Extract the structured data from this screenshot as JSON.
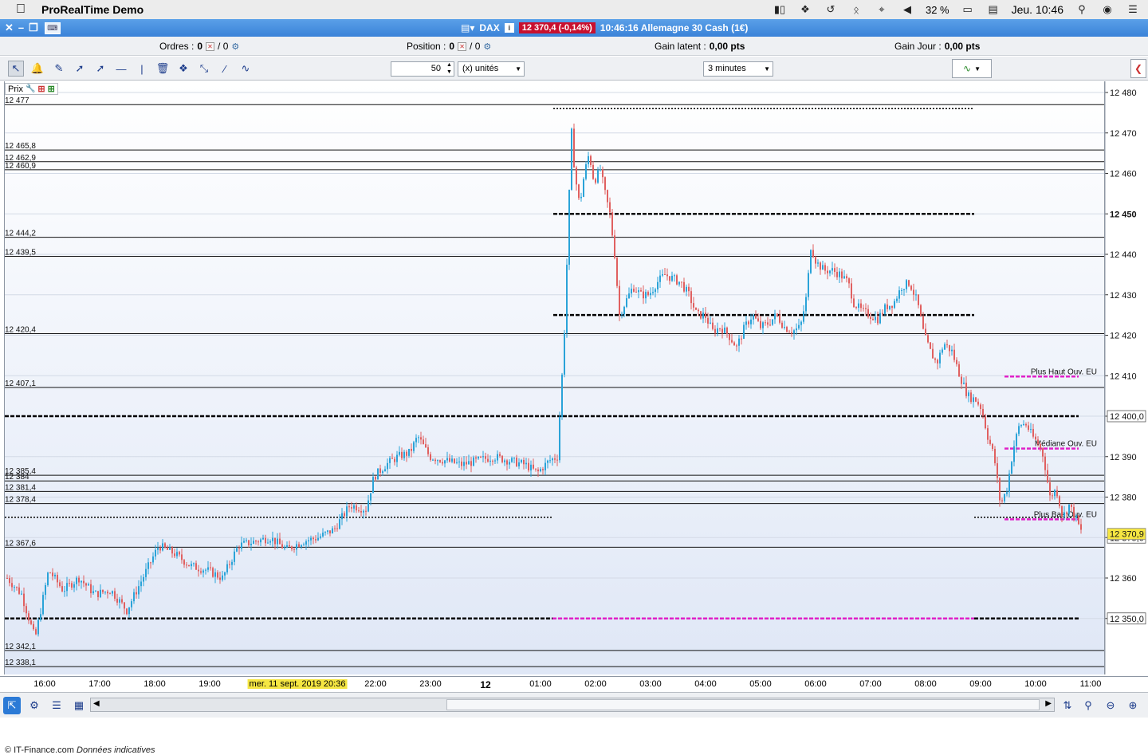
{
  "menubar": {
    "app_name": "ProRealTime Demo",
    "battery": "32 %",
    "clock": "Jeu. 10:46"
  },
  "titlebar": {
    "instrument": "DAX",
    "price_change": "12 370,4 (-0,14%)",
    "info": "10:46:16 Allemagne 30 Cash (1€)"
  },
  "orderbar": {
    "orders_label": "Ordres :",
    "orders_value": "0",
    "orders_sep": "/ 0",
    "position_label": "Position :",
    "position_value": "0",
    "position_sep": "/ 0",
    "gain_latent_label": "Gain latent :",
    "gain_latent_value": "0,00 pts",
    "gain_jour_label": "Gain Jour :",
    "gain_jour_value": "0,00 pts"
  },
  "toolbar": {
    "quantity": "50",
    "unit_select": "(x) unités",
    "timeframe_select": "3 minutes"
  },
  "chart": {
    "prix_label": "Prix",
    "footer_source": "© IT-Finance.com",
    "footer_note": "Données indicatives",
    "time_labels": [
      "16:00",
      "17:00",
      "18:00",
      "19:00",
      "mer. 11 sept. 2019 20:36",
      "22:00",
      "23:00",
      "12",
      "01:00",
      "02:00",
      "03:00",
      "04:00",
      "05:00",
      "06:00",
      "07:00",
      "08:00",
      "09:00",
      "10:00",
      "11:00"
    ]
  },
  "chart_data": {
    "type": "candlestick",
    "title": "DAX",
    "timeframe": "3 minutes",
    "y_axis_ticks": [
      12480,
      12470,
      12460,
      12450,
      12440,
      12430,
      12420,
      12410,
      12400,
      12390,
      12380,
      12370,
      12360,
      12350
    ],
    "y_axis_labels": [
      "12 480",
      "12 470",
      "12 460",
      "12 450",
      "12 440",
      "12 430",
      "12 420",
      "12 410",
      "12 400,0",
      "12 390",
      "12 380",
      "12 375,0",
      "12 360",
      "12 350,0"
    ],
    "ylim": [
      12337,
      12483
    ],
    "last_price": "12 370,9",
    "horizontal_levels": [
      {
        "label": "12 477",
        "value": 12477
      },
      {
        "label": "12 465,8",
        "value": 12465.8
      },
      {
        "label": "12 462,9",
        "value": 12462.9
      },
      {
        "label": "12 460,9",
        "value": 12460.9
      },
      {
        "label": "12 444,2",
        "value": 12444.2
      },
      {
        "label": "12 439,5",
        "value": 12439.5
      },
      {
        "label": "12 420,4",
        "value": 12420.4
      },
      {
        "label": "12 407,1",
        "value": 12407.1
      },
      {
        "label": "12 385,4",
        "value": 12385.4
      },
      {
        "label": "12 384",
        "value": 12384
      },
      {
        "label": "12 381,4",
        "value": 12381.4
      },
      {
        "label": "12 378,4",
        "value": 12378.4
      },
      {
        "label": "12 367,6",
        "value": 12367.6
      },
      {
        "label": "12 342,1",
        "value": 12342.1
      },
      {
        "label": "12 338,1",
        "value": 12338.1
      }
    ],
    "annotations": [
      {
        "text": "Plus Haut Ouv. EU",
        "value": 12409.8
      },
      {
        "text": "Médiane Ouv. EU",
        "value": 12392
      },
      {
        "text": "Plus Bas Ouv. EU",
        "value": 12374.5
      }
    ],
    "close_path": [
      [
        0,
        12360
      ],
      [
        18,
        12356
      ],
      [
        35,
        12345
      ],
      [
        52,
        12362
      ],
      [
        70,
        12357
      ],
      [
        90,
        12360
      ],
      [
        110,
        12356
      ],
      [
        130,
        12357
      ],
      [
        150,
        12352
      ],
      [
        170,
        12360
      ],
      [
        190,
        12368
      ],
      [
        210,
        12366
      ],
      [
        230,
        12363
      ],
      [
        250,
        12362
      ],
      [
        270,
        12360
      ],
      [
        290,
        12368
      ],
      [
        310,
        12369
      ],
      [
        330,
        12370
      ],
      [
        350,
        12367
      ],
      [
        370,
        12369
      ],
      [
        390,
        12370
      ],
      [
        410,
        12372
      ],
      [
        430,
        12378
      ],
      [
        450,
        12377
      ],
      [
        460,
        12385
      ],
      [
        475,
        12388
      ],
      [
        490,
        12390
      ],
      [
        505,
        12391
      ],
      [
        515,
        12395
      ],
      [
        530,
        12390
      ],
      [
        550,
        12389
      ],
      [
        570,
        12388
      ],
      [
        590,
        12389
      ],
      [
        610,
        12390
      ],
      [
        630,
        12389
      ],
      [
        650,
        12388
      ],
      [
        665,
        12386
      ],
      [
        680,
        12389
      ],
      [
        690,
        12390
      ],
      [
        696,
        12410
      ],
      [
        700,
        12425
      ],
      [
        704,
        12450
      ],
      [
        708,
        12470
      ],
      [
        712,
        12460
      ],
      [
        718,
        12452
      ],
      [
        724,
        12460
      ],
      [
        730,
        12465
      ],
      [
        736,
        12458
      ],
      [
        744,
        12461
      ],
      [
        750,
        12455
      ],
      [
        756,
        12450
      ],
      [
        762,
        12440
      ],
      [
        768,
        12425
      ],
      [
        775,
        12428
      ],
      [
        785,
        12432
      ],
      [
        795,
        12430
      ],
      [
        805,
        12430
      ],
      [
        815,
        12433
      ],
      [
        825,
        12435
      ],
      [
        835,
        12434
      ],
      [
        845,
        12433
      ],
      [
        855,
        12430
      ],
      [
        865,
        12425
      ],
      [
        875,
        12425
      ],
      [
        885,
        12421
      ],
      [
        895,
        12422
      ],
      [
        905,
        12420
      ],
      [
        915,
        12417
      ],
      [
        925,
        12422
      ],
      [
        935,
        12425
      ],
      [
        945,
        12422
      ],
      [
        955,
        12423
      ],
      [
        965,
        12425
      ],
      [
        975,
        12422
      ],
      [
        985,
        12421
      ],
      [
        995,
        12422
      ],
      [
        1003,
        12430
      ],
      [
        1008,
        12442
      ],
      [
        1015,
        12438
      ],
      [
        1025,
        12436
      ],
      [
        1035,
        12436
      ],
      [
        1045,
        12435
      ],
      [
        1055,
        12433
      ],
      [
        1062,
        12428
      ],
      [
        1072,
        12426
      ],
      [
        1082,
        12425
      ],
      [
        1092,
        12424
      ],
      [
        1102,
        12427
      ],
      [
        1112,
        12428
      ],
      [
        1122,
        12432
      ],
      [
        1132,
        12433
      ],
      [
        1142,
        12428
      ],
      [
        1150,
        12420
      ],
      [
        1158,
        12416
      ],
      [
        1166,
        12413
      ],
      [
        1175,
        12418
      ],
      [
        1185,
        12416
      ],
      [
        1195,
        12410
      ],
      [
        1205,
        12405
      ],
      [
        1215,
        12404
      ],
      [
        1222,
        12402
      ],
      [
        1230,
        12395
      ],
      [
        1238,
        12390
      ],
      [
        1246,
        12378
      ],
      [
        1254,
        12382
      ],
      [
        1262,
        12392
      ],
      [
        1270,
        12398
      ],
      [
        1278,
        12398
      ],
      [
        1286,
        12395
      ],
      [
        1294,
        12393
      ],
      [
        1300,
        12390
      ],
      [
        1308,
        12380
      ],
      [
        1316,
        12382
      ],
      [
        1324,
        12375
      ],
      [
        1332,
        12378
      ],
      [
        1340,
        12375
      ],
      [
        1348,
        12371
      ],
      [
        1352,
        12370.9
      ]
    ]
  }
}
